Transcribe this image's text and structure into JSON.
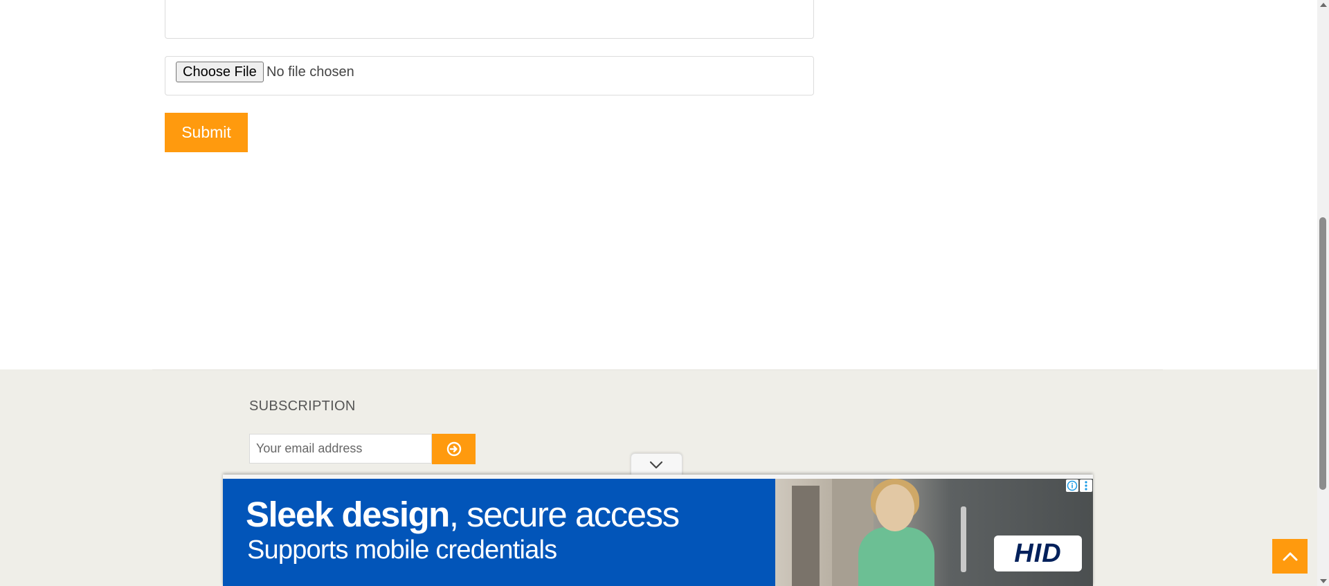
{
  "form": {
    "file_button_label": "Choose File",
    "file_status": "No file chosen",
    "submit_label": "Submit"
  },
  "footer": {
    "subscription_title": "SUBSCRIPTION",
    "email_placeholder": "Your email address",
    "email_submit_icon": "arrow-circle-right-icon"
  },
  "ad": {
    "headline_bold": "Sleek design",
    "headline_rest": ", secure access",
    "subline": "Supports mobile credentials",
    "brand": "HID",
    "toggle_icon": "chevron-down-icon",
    "background_color": "#0255b9"
  },
  "back_to_top_icon": "chevron-up-icon",
  "colors": {
    "accent": "#ff9a0e",
    "footer_bg": "#efeee8"
  }
}
